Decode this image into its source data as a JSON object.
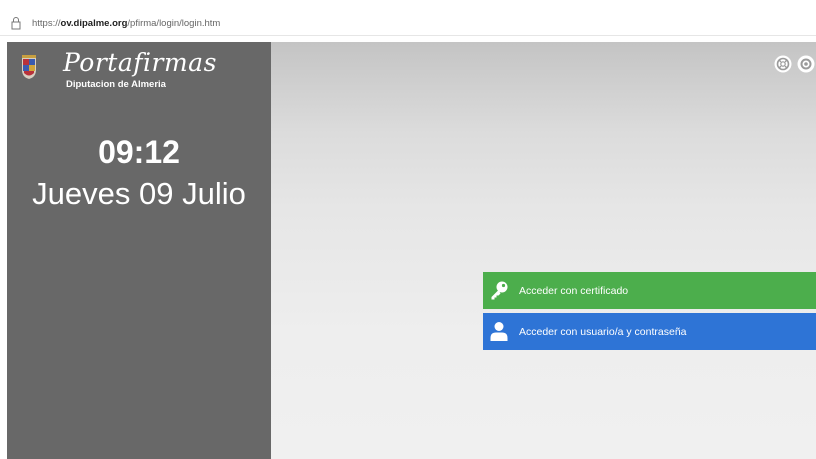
{
  "browser": {
    "url_prefix": "https://",
    "url_domain": "ov.dipalme.org",
    "url_path": "/pfirma/login/login.htm",
    "icon": "lock-icon"
  },
  "sidebar": {
    "app_name": "Portafirmas",
    "subtitle": "Diputacion de Almeria",
    "time": "09:12",
    "date": "Jueves 09 Julio",
    "crest_icon": "coat-of-arms-icon",
    "background": "#686868"
  },
  "main": {
    "header_icons": [
      "help-icon",
      "settings-icon"
    ],
    "buttons": {
      "certificate": {
        "label": "Acceder con certificado",
        "icon": "key-icon",
        "color": "#4cae4c"
      },
      "user": {
        "label": "Acceder con usuario/a y contraseña",
        "icon": "user-icon",
        "color": "#2e74d6"
      }
    }
  }
}
